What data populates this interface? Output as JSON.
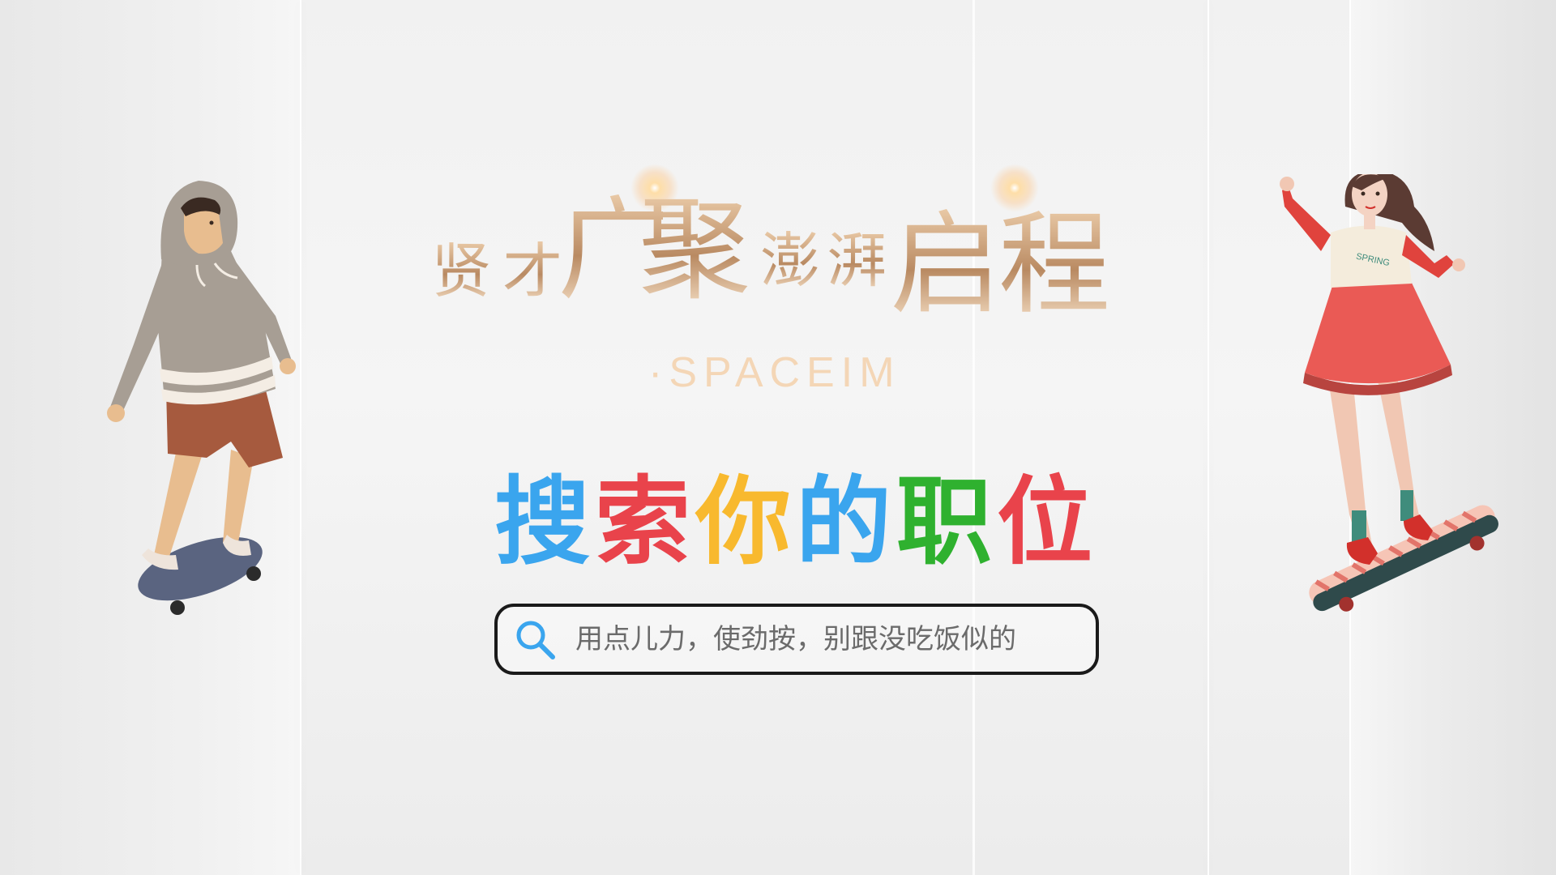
{
  "hero": {
    "chars": [
      "贤",
      "才",
      "广",
      "聚",
      "澎",
      "湃",
      "启",
      "程"
    ],
    "subtitle": "·SPACEIM"
  },
  "slogan": {
    "chars": [
      {
        "text": "搜",
        "color": "#3aa5ee"
      },
      {
        "text": "索",
        "color": "#e9434b"
      },
      {
        "text": "你",
        "color": "#f8b92e"
      },
      {
        "text": "的",
        "color": "#3aa5ee"
      },
      {
        "text": "职",
        "color": "#2fb12f"
      },
      {
        "text": "位",
        "color": "#e9434b"
      }
    ]
  },
  "search": {
    "placeholder": "用点儿力，使劲按，别跟没吃饭似的",
    "icon": "search-icon",
    "icon_color": "#3aa5ee"
  },
  "figures": {
    "left": "boy-skateboarder-illustration",
    "right": "girl-skateboarder-illustration"
  }
}
